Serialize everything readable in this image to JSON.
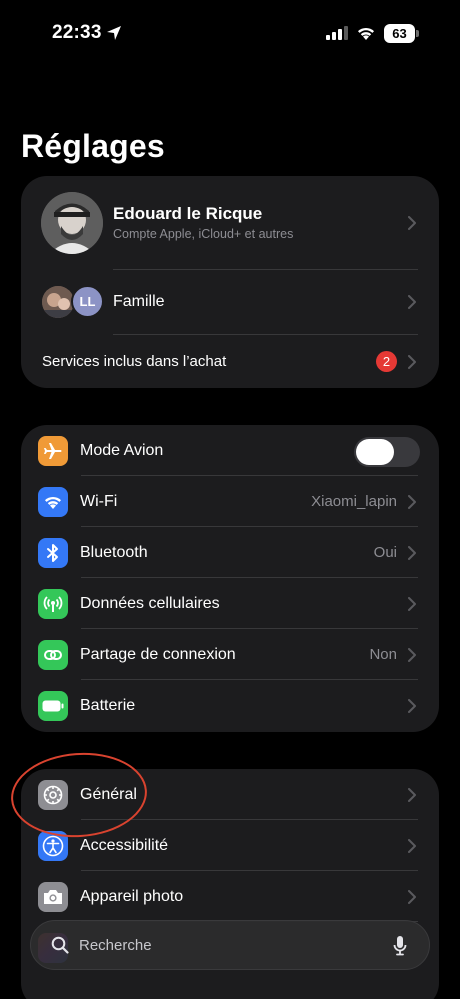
{
  "status": {
    "time": "22:33",
    "battery": "63"
  },
  "title": "Réglages",
  "profile": {
    "name": "Edouard le Ricque",
    "subtitle": "Compte Apple, iCloud+ et autres",
    "family_label": "Famille",
    "family_initials": "LL",
    "services_label": "Services inclus dans l’achat",
    "services_badge": "2"
  },
  "connectivity": [
    {
      "label": "Mode Avion",
      "value": "",
      "color": "#f09a37"
    },
    {
      "label": "Wi-Fi",
      "value": "Xiaomi_lapin",
      "color": "#3478f6"
    },
    {
      "label": "Bluetooth",
      "value": "Oui",
      "color": "#3478f6"
    },
    {
      "label": "Données cellulaires",
      "value": "",
      "color": "#34c759"
    },
    {
      "label": "Partage de connexion",
      "value": "Non",
      "color": "#34c759"
    },
    {
      "label": "Batterie",
      "value": "",
      "color": "#34c759"
    }
  ],
  "airplane_mode_on": false,
  "general": [
    {
      "label": "Général",
      "color": "#8e8e93"
    },
    {
      "label": "Accessibilité",
      "color": "#3478f6"
    },
    {
      "label": "Appareil photo",
      "color": "#8e8e93"
    }
  ],
  "search": {
    "placeholder": "Recherche"
  }
}
